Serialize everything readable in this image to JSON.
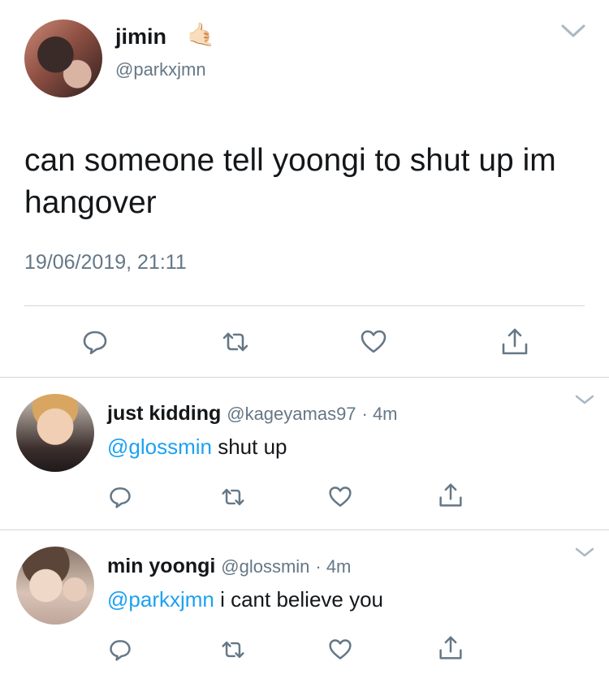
{
  "main_tweet": {
    "name": "jimin",
    "emoji": "🤙🏻",
    "handle": "@parkxjmn",
    "text": "can someone tell yoongi to shut up im hangover",
    "timestamp": "19/06/2019, 21:11"
  },
  "replies": [
    {
      "name": "just kidding",
      "handle": "@kageyamas97",
      "time": "· 4m",
      "mention": "@glossmin",
      "text": " shut up"
    },
    {
      "name": "min yoongi",
      "handle": "@glossmin",
      "time": "· 4m",
      "mention": "@parkxjmn",
      "text": " i cant believe you"
    }
  ],
  "icons": {
    "reply": "reply-icon",
    "retweet": "retweet-icon",
    "like": "heart-icon",
    "share": "share-icon",
    "menu": "chevron-down-icon"
  },
  "colors": {
    "text": "#14171a",
    "secondary": "#657786",
    "mention": "#1da1f2",
    "divider": "#cfd6dc"
  }
}
